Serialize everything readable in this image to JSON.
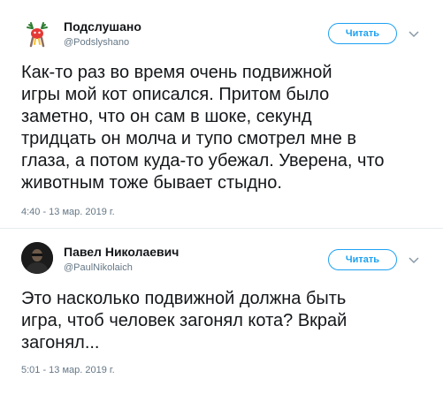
{
  "tweets": [
    {
      "author": {
        "name": "Подслушано",
        "handle": "@Podslyshano",
        "avatar_icon": "reindeer-avatar-icon"
      },
      "follow_label": "Читать",
      "text": "Как-то раз во время очень подвижной\nигры мой кот описался. Притом было\nзаметно, что он сам в шоке, секунд\nтридцать он молча и тупо смотрел мне в\nглаза, а потом куда-то убежал. Уверена, что\nживотным тоже бывает стыдно.",
      "timestamp": "4:40 - 13 мар. 2019 г."
    },
    {
      "author": {
        "name": "Павел Николаевич",
        "handle": "@PaulNikolaich",
        "avatar_icon": "person-photo-avatar"
      },
      "follow_label": "Читать",
      "text": "Это насколько подвижной должна быть\nигра, чтоб человек загонял кота? Вкрай\nзагонял...",
      "timestamp": "5:01 - 13 мар. 2019 г."
    }
  ],
  "colors": {
    "accent": "#1da1f2",
    "text": "#14171a",
    "muted": "#657786",
    "divider": "#e6ecf0"
  }
}
